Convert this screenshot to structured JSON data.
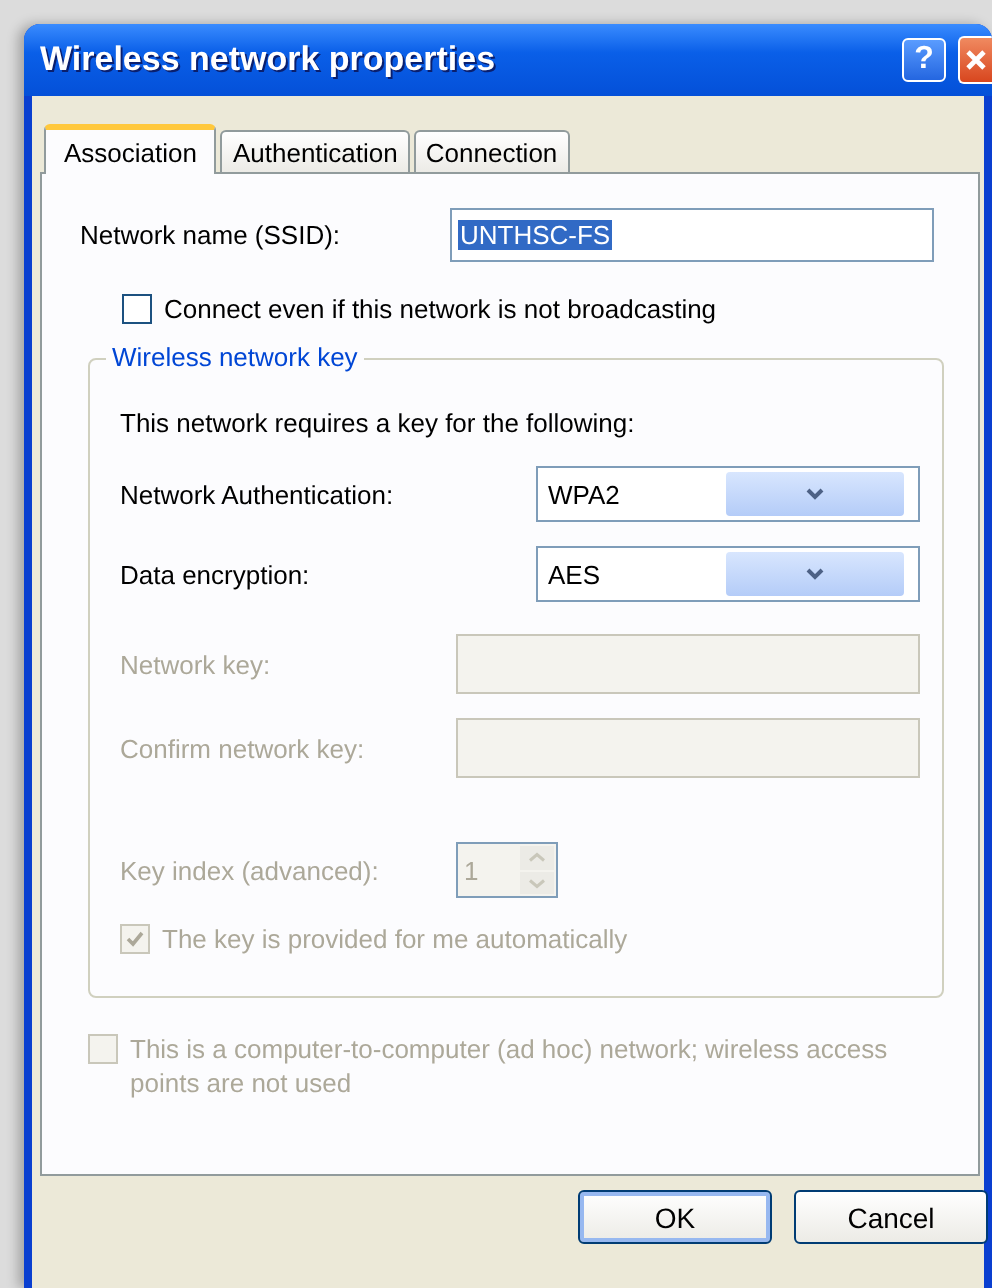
{
  "window": {
    "title": "Wireless network properties",
    "help_button": "?"
  },
  "tabs": [
    {
      "label": "Association",
      "selected": true
    },
    {
      "label": "Authentication",
      "selected": false
    },
    {
      "label": "Connection",
      "selected": false
    }
  ],
  "ssid": {
    "label": "Network name (SSID):",
    "value": "UNTHSC-FS"
  },
  "broadcast_check": {
    "label": "Connect even if this network is not broadcasting",
    "checked": false,
    "disabled": false
  },
  "key_group": {
    "title": "Wireless network key",
    "intro": "This network requires a key for the following:",
    "fields": [
      {
        "kind": "select",
        "label": "Network Authentication:",
        "value": "WPA2",
        "disabled": false
      },
      {
        "kind": "select",
        "label": "Data encryption:",
        "value": "AES",
        "disabled": false
      },
      {
        "kind": "text",
        "label": "Network key:",
        "disabled": true
      },
      {
        "kind": "text",
        "label": "Confirm network key:",
        "disabled": true
      },
      {
        "kind": "spin",
        "label": "Key index (advanced):",
        "value": "1",
        "disabled": true
      }
    ],
    "auto_key": {
      "label": "The key is provided for me automatically",
      "checked": true,
      "disabled": true
    }
  },
  "adhoc": {
    "label": "This is a computer-to-computer (ad hoc) network; wireless access points are not used",
    "checked": false,
    "disabled": true
  },
  "buttons": [
    {
      "label": "OK",
      "default": true
    },
    {
      "label": "Cancel",
      "default": false
    }
  ]
}
